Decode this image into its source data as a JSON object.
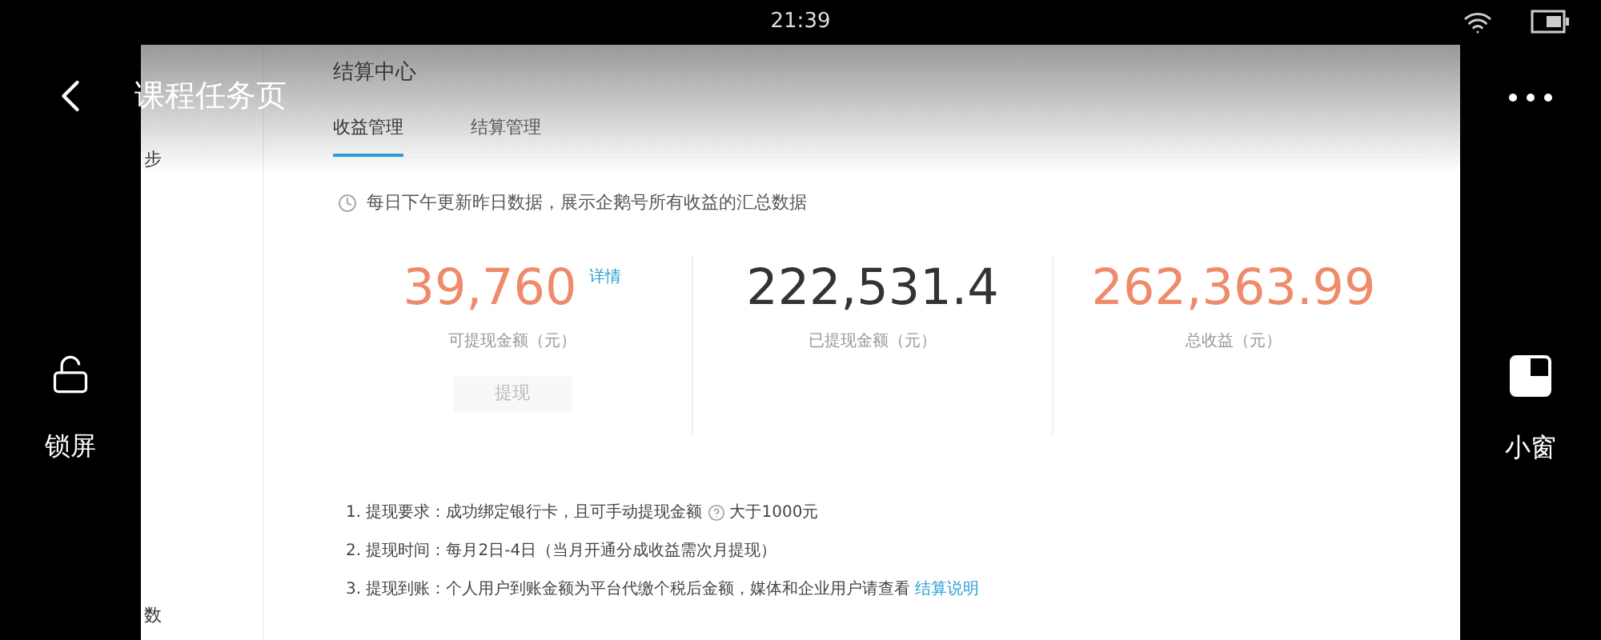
{
  "status_bar": {
    "time": "21:39"
  },
  "player": {
    "title": "课程任务页",
    "lock_label": "锁屏",
    "mini_window_label": "小窗"
  },
  "sidebar": {
    "items": [
      {
        "label": "步"
      },
      {
        "label": "数"
      }
    ]
  },
  "page": {
    "title": "结算中心",
    "tabs": [
      {
        "label": "收益管理",
        "selected": true
      },
      {
        "label": "结算管理",
        "selected": false
      }
    ],
    "notice": "每日下午更新昨日数据，展示企鹅号所有收益的汇总数据",
    "stats": [
      {
        "value": "39,760",
        "color": "#ef8a6a",
        "link": "详情",
        "label": "可提现金额（元）",
        "button": {
          "label": "提现",
          "disabled": true
        }
      },
      {
        "value": "222,531.4",
        "color": "#333333",
        "label": "已提现金额（元）"
      },
      {
        "value": "262,363.99",
        "color": "#ef8a6a",
        "label": "总收益（元）"
      }
    ],
    "rules": [
      {
        "text": "1. 提现要求：成功绑定银行卡，且可手动提现金额",
        "after": "大于1000元"
      },
      {
        "text": "2. 提现时间：每月2日-4日（当月开通分成收益需次月提现）"
      },
      {
        "text": "3. 提现到账：个人用户到账金额为平台代缴个税后金额，媒体和企业用户请查看",
        "link": "结算说明"
      }
    ]
  }
}
